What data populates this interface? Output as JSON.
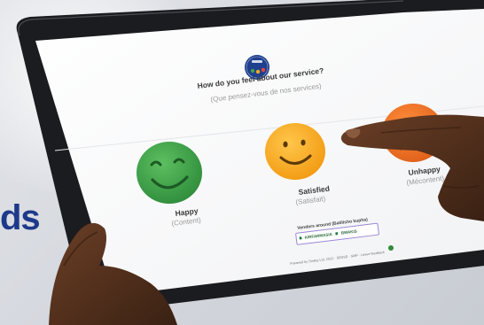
{
  "survey": {
    "question_en": "How do you feel about our service?",
    "question_fr": "(Que pensez-vous de nos services)",
    "options": [
      {
        "label": "Happy",
        "sublabel": "(Content)",
        "color": "#3fa34d"
      },
      {
        "label": "Satisfied",
        "sublabel": "(Satisfait)",
        "color": "#f5a623"
      },
      {
        "label": "Unhappy",
        "sublabel": "(Mécontent)",
        "color": "#f0751f"
      }
    ],
    "vendors_title": "Vendors around (Batilisho kupha)",
    "vendor_1": "KIRFARMASIA",
    "vendor_2": "BWAKIS",
    "footer": "Powered by Smiley Ltd. 2022 · SENSE · SMP · Leave feedback"
  },
  "background": {
    "partial_word": "ds",
    "brand_color": "#1d3a8a"
  }
}
